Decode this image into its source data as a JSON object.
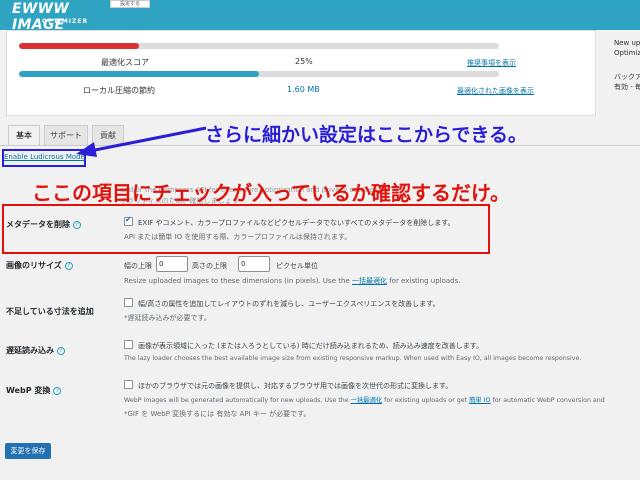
{
  "header": {
    "logo_main": "EWWW IMAGE",
    "logo_sub": "OPTIMIZER",
    "button_label": "設定する"
  },
  "stats": {
    "score": {
      "label": "最適化スコア",
      "value": "25%",
      "link": "推奨事項を表示",
      "percent": 25,
      "color": "#dc3232"
    },
    "local": {
      "label": "ローカル圧縮の節約",
      "value": "1.60 MB",
      "link": "最適化された画像を表示",
      "percent": 50,
      "color": "#2ea3c2"
    },
    "right_top": [
      "New up",
      "Optimiz"
    ],
    "right_bottom": [
      "バックア",
      "有効 - 毎"
    ]
  },
  "tabs": [
    {
      "label": "基本"
    },
    {
      "label": "サポート"
    },
    {
      "label": "貢献"
    }
  ],
  "ludicrous_link": "Enable Ludicrous Mode",
  "annotations": {
    "blue": "さらに細かい設定はここからできる。",
    "red": "ここの項目にチェックが入っているか確認するだけ。"
  },
  "faded_lines": [
    "and/or the Compress API for even more optimization and privacy settings",
    "ボラリティスのため、確認しましょう"
  ],
  "settings": {
    "metadata": {
      "label": "メタデータを削除",
      "checked": true,
      "line1": "EXIF やコメント、カラープロファイルなどピクセルデータでないすべてのメタデータを削除します。",
      "line2": "API または簡単 IO を使用する際、カラープロファイルは保持されます。"
    },
    "resize": {
      "label": "画像のリサイズ",
      "width_label": "幅の上限",
      "width_value": "0",
      "height_label": "高さの上限",
      "height_value": "0",
      "unit": "ピクセル単位",
      "desc_pre": "Resize uploaded images to these dimensions (in pixels). Use the",
      "desc_link": "一括最適化",
      "desc_post": "for existing uploads."
    },
    "dimensions": {
      "label": "不足している寸法を追加",
      "line1": "幅/高さの属性を追加してレイアウトのずれを減らし、ユーザーエクスペリエンスを改善します。",
      "line2": "*遅延読み込みが必要です。"
    },
    "lazy": {
      "label": "遅延読み込み",
      "line1": "画像が表示領域に入った (または入ろうとしている) 時にだけ読み込まれるため、読み込み速度を改善します。",
      "line2": "The lazy loader chooses the best available image size from existing responsive markup. When used with Easy IO, all images become responsive."
    },
    "webp": {
      "label": "WebP 変換",
      "line1": "ほかのブラウザでは元の画像を提供し、対応するブラウザ用では画像を次世代の形式に変換します。",
      "line2_pre": "WebP images will be generated automatically for new uploads. Use the",
      "line2_link1": "一括最適化",
      "line2_mid": "for existing uploads or get",
      "line2_link2": "簡単 IO",
      "line2_post": "for automatic WebP conversion and",
      "line3": "*GIF を WebP 変換するには 有効な API キー が必要です。"
    }
  },
  "save_button": "変更を保存",
  "colors": {
    "banner": "#2ea3c2",
    "annotation_blue": "#2b1fd6",
    "annotation_red": "#e0120b",
    "link": "#0073aa"
  }
}
